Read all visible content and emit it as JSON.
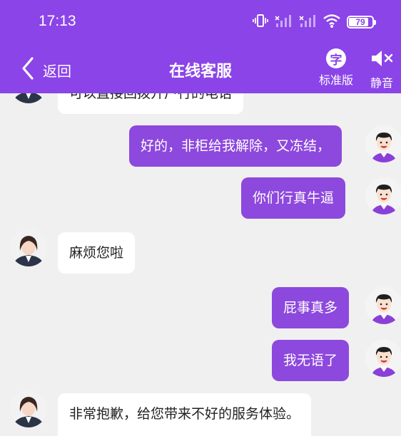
{
  "status_bar": {
    "time": "17:13",
    "battery": "79",
    "icons": [
      "vibrate-icon",
      "signal-icon",
      "wifi-icon",
      "battery-icon"
    ]
  },
  "header": {
    "back_label": "返回",
    "title": "在线客服",
    "standard_icon_char": "字",
    "standard_label": "标准版",
    "mute_label": "静音"
  },
  "messages": [
    {
      "sender": "agent",
      "text": "可以直接回拨开户行的电话"
    },
    {
      "sender": "user",
      "text": "好的，非柜给我解除，又冻结，"
    },
    {
      "sender": "user",
      "text": "你们行真牛逼"
    },
    {
      "sender": "agent",
      "text": "麻烦您啦"
    },
    {
      "sender": "user",
      "text": "屁事真多"
    },
    {
      "sender": "user",
      "text": "我无语了"
    },
    {
      "sender": "agent",
      "text": "非常抱歉，给您带来不好的服务体验。"
    }
  ],
  "colors": {
    "header_bg": "#8b44e8",
    "user_bubble": "#8d48dd",
    "agent_bubble": "#ffffff",
    "chat_bg": "#f0f0f0"
  }
}
